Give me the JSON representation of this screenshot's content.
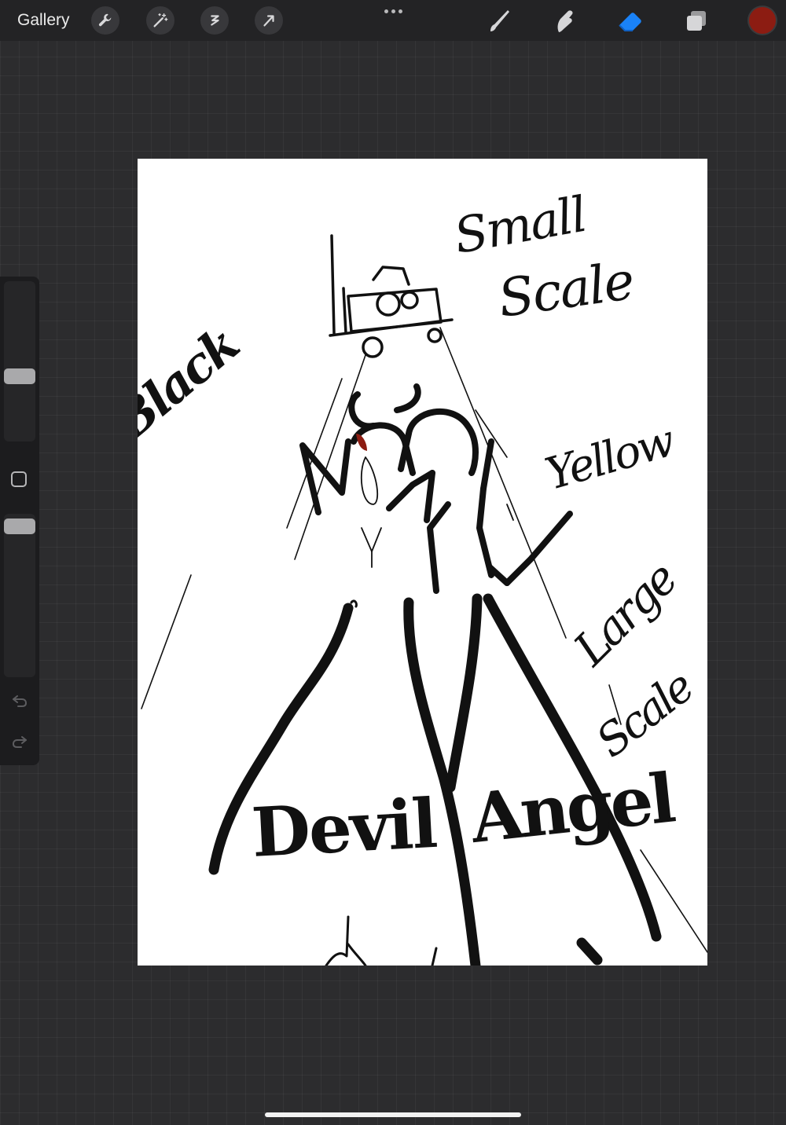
{
  "toolbar": {
    "gallery_label": "Gallery",
    "left_tools": [
      "wrench-icon",
      "magic-wand-icon",
      "selection-icon",
      "transform-arrow-icon"
    ],
    "right_tools": [
      "brush-icon",
      "smudge-icon",
      "eraser-icon",
      "layers-icon"
    ],
    "active_tool": "eraser",
    "current_color": "#8c1c12"
  },
  "sidebar": {
    "controls": [
      "brush-size-slider",
      "modify-button",
      "opacity-slider",
      "undo-icon",
      "redo-icon"
    ]
  },
  "canvas": {
    "background": "#ffffff",
    "annotations": {
      "small": "Small",
      "scale": "Scale",
      "black": "Black",
      "yellow": "Yellow",
      "large": "Large",
      "scale2": "Scale",
      "devil": "Devil",
      "angel": "Angel"
    }
  }
}
